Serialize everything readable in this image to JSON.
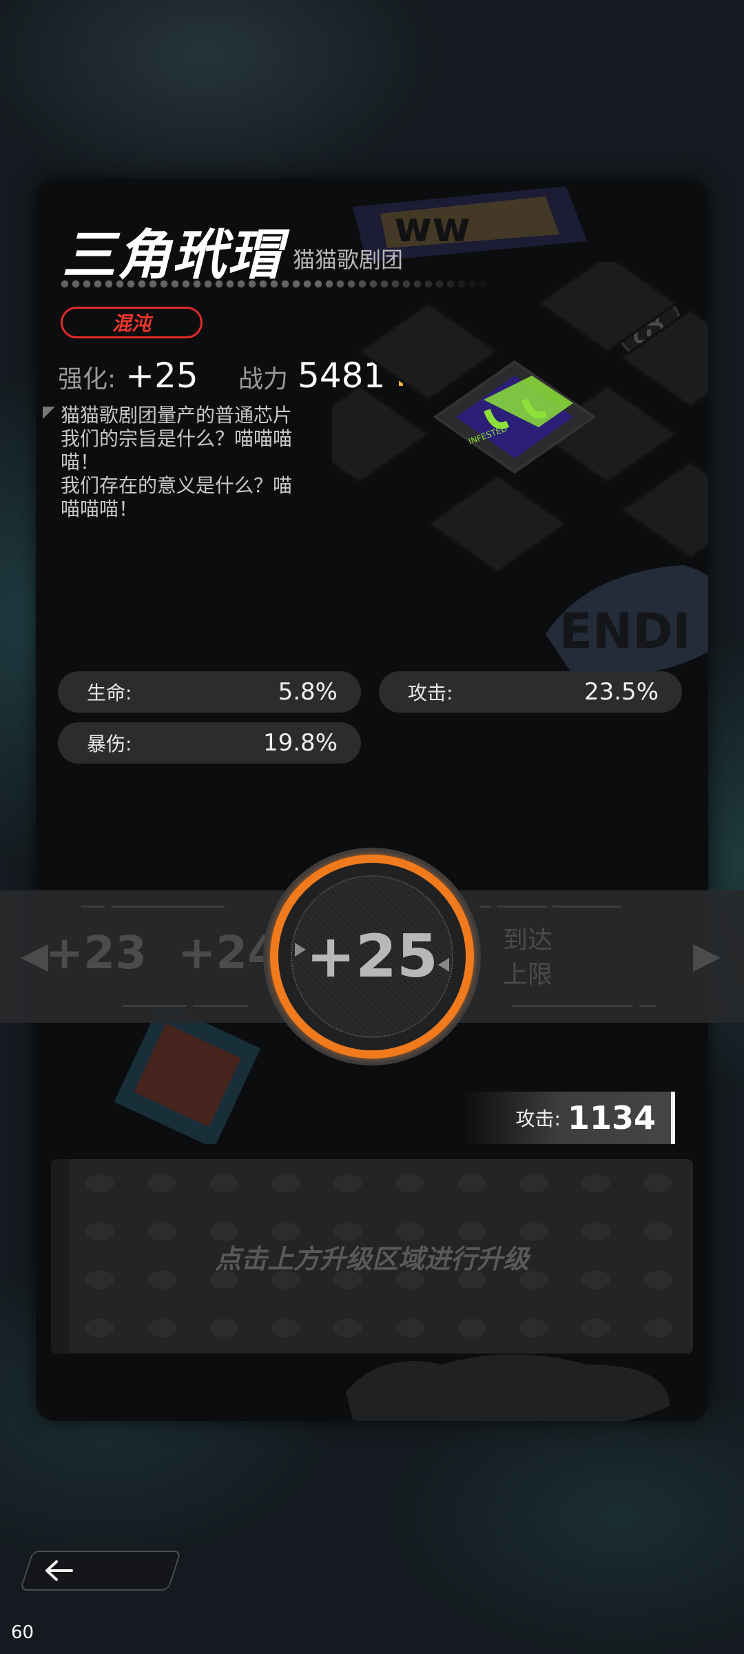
{
  "item": {
    "name": "三角玳瑁",
    "series": "猫猫歌剧团",
    "rarity_tag": "混沌",
    "enhance_label": "强化:",
    "enhance_value": "+25",
    "power_label": "战力",
    "power_value": "5481",
    "description": "猫猫歌剧团量产的普通芯片\n我们的宗旨是什么？喵喵喵\n喵！\n我们存在的意义是什么？喵\n喵喵喵！"
  },
  "attributes": [
    {
      "label": "生命:",
      "value": "5.8%"
    },
    {
      "label": "攻击:",
      "value": "23.5%"
    },
    {
      "label": "暴伤:",
      "value": "19.8%"
    }
  ],
  "level_selector": {
    "prev2": "+23",
    "prev1": "+24",
    "current": "+25",
    "limit_text": "到达\n上限"
  },
  "attack_result": {
    "label": "攻击:",
    "value": "1134"
  },
  "upgrade_hint": "点击上方升级区域进行升级",
  "fps": "60",
  "colors": {
    "accent_orange": "#f07a1c",
    "rarity_red": "#e02a2a",
    "power_up_arrow": "#f5b53a"
  }
}
